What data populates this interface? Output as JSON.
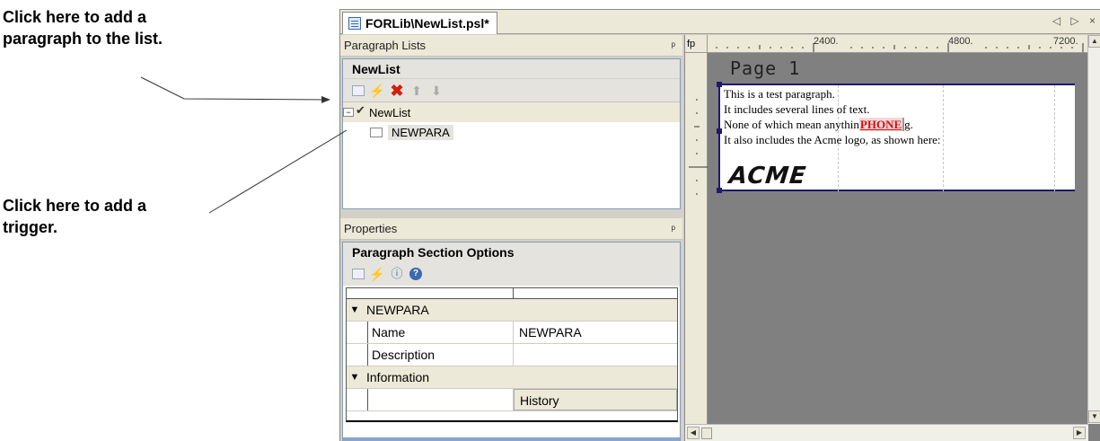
{
  "callouts": {
    "add_paragraph": [
      "Click here to add a",
      "paragraph to the list."
    ],
    "add_trigger": [
      "Click here to add a",
      "trigger."
    ]
  },
  "window": {
    "doc_tab_title": "FORLib\\NewList.psl*",
    "tab_nav": "◁ ▷ ×"
  },
  "paragraph_lists": {
    "panel_title": "Paragraph Lists",
    "header": "NewList",
    "toolbar": [
      "add-paragraph-icon",
      "trigger-icon",
      "delete-icon",
      "move-up-icon",
      "move-down-icon"
    ],
    "tree": {
      "root_label": "NewList",
      "child_label": "NEWPARA"
    }
  },
  "properties": {
    "panel_title": "Properties",
    "header": "Paragraph Section Options",
    "toolbar": [
      "paragraph-icon",
      "trigger-icon",
      "info-icon",
      "help-icon"
    ],
    "grid": {
      "section1": "NEWPARA",
      "rows1": [
        {
          "name": "Name",
          "value": "NEWPARA"
        },
        {
          "name": "Description",
          "value": ""
        }
      ],
      "section2": "Information",
      "rows2": [
        {
          "name": "",
          "value": "History"
        }
      ]
    }
  },
  "canvas": {
    "corner_label": "fp",
    "ruler_labels": [
      "2400.",
      "4800.",
      "7200."
    ],
    "page_label": "Page 1",
    "paragraph": {
      "line1": "This is a test paragraph.",
      "line2": "It includes several lines of text.",
      "line3_before": "None of which mean anythin",
      "line3_field": "PHONE",
      "line3_after": "g.",
      "line4": "It also includes the Acme logo, as shown here:",
      "logo_text": "ACME"
    }
  },
  "colors": {
    "selection_border": "#1b1b6e",
    "field_text": "#d01010",
    "canvas_bg": "#808080",
    "panel_bg": "#d4d0c8"
  }
}
